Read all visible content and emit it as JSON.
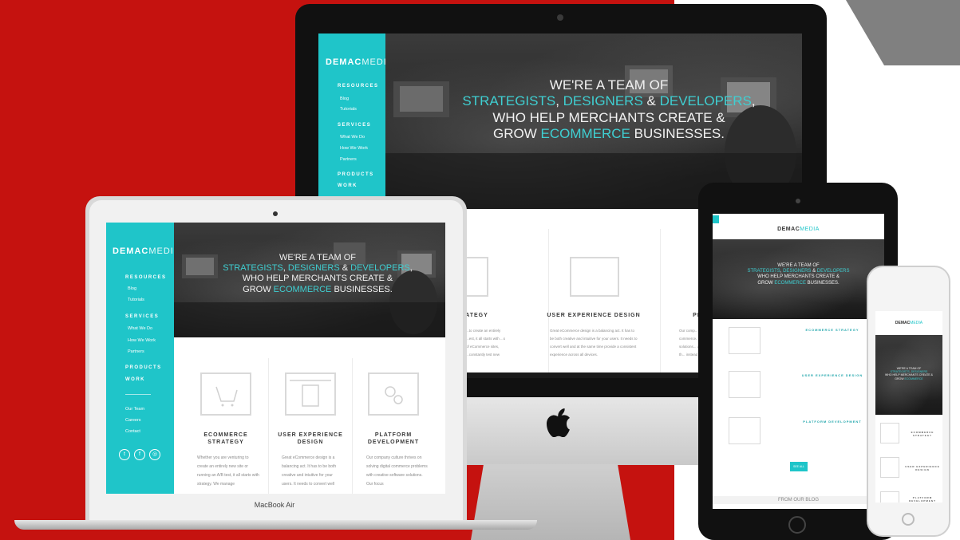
{
  "brand": {
    "logo_bold": "DEMAC",
    "logo_light": "MEDIA",
    "accent_color": "#3fcfd2",
    "background_red": "#c5120f"
  },
  "nav": {
    "resources": "RESOURCES",
    "blog": "Blog",
    "tutorials": "Tutorials",
    "services": "SERVICES",
    "what_we_do": "What We Do",
    "how_we_work": "How We Work",
    "partners": "Partners",
    "products": "PRODUCTS",
    "work": "WORK",
    "our_team": "Our Team",
    "careers": "Careers",
    "contact": "Contact"
  },
  "hero": {
    "line1": "WE'RE A TEAM OF",
    "strategists": "STRATEGISTS",
    "comma1": ", ",
    "designers": "DESIGNERS",
    "amp": " & ",
    "developers": "DEVELOPERS",
    "comma2": ",",
    "line3": "WHO HELP MERCHANTS CREATE &",
    "grow": "GROW ",
    "ecommerce": "ECOMMERCE",
    "businesses": " BUSINESSES."
  },
  "services": {
    "ecommerce_title": "ECOMMERCE STRATEGY",
    "ecommerce_text": "Whether you are venturing to create an entirely new site or running an A/B test, it all starts with strategy. We manage",
    "ux_title": "USER EXPERIENCE DESIGN",
    "ux_text": "Great eCommerce design is a balancing act. It has to be both creative and intuitive for your users. It needs to convert well",
    "ux_text_imac": "Great eCommerce design is a balancing act. It has to be both creative and intuitive for your users. It needs to convert well and at the same time provide a consistent experience across all devices.",
    "platform_title": "PLATFORM DEVELOPMENT",
    "platform_text": "Our company culture thrives on solving digital commerce problems with creative software solutions. Our focus",
    "strategy_short": "STRATEGY",
    "strategy_text_imac": "...to create an entirely ...est, it all starts with ...s of eCommerce sites, ...constantly test new",
    "platform_short": "PLAT",
    "platform_text_imac": "Our comp... commerce... solutions... given us th... instead of"
  },
  "ipad": {
    "see_all": "SEE ALL",
    "from_blog": "FROM OUR BLOG"
  },
  "devices": {
    "macbook_label": "MacBook Air"
  },
  "icons": [
    "menu-icon",
    "twitter-icon",
    "facebook-icon",
    "instagram-icon",
    "cart-icon",
    "browser-icon",
    "gears-icon",
    "apple-logo-icon"
  ]
}
